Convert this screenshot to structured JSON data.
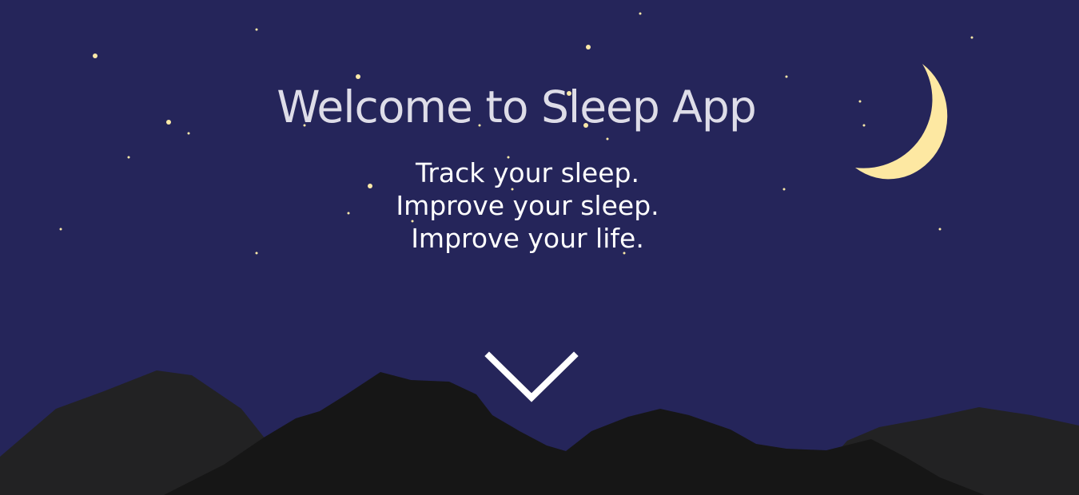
{
  "hero": {
    "title": "Welcome to Sleep App",
    "tagline": [
      "Track your sleep.",
      "Improve your sleep.",
      "Improve your life."
    ]
  },
  "icons": {
    "scroll_down": "chevron-down-icon",
    "moon": "crescent-moon-icon",
    "stars": "star-dots",
    "mountains": "mountain-silhouette"
  },
  "colors": {
    "sky": "#25255a",
    "moon": "#fde8a2",
    "star": "#fbe9a8",
    "title": "#dedde8",
    "text": "#ffffff",
    "mountain_back": "#222223",
    "mountain_front": "#161616"
  }
}
